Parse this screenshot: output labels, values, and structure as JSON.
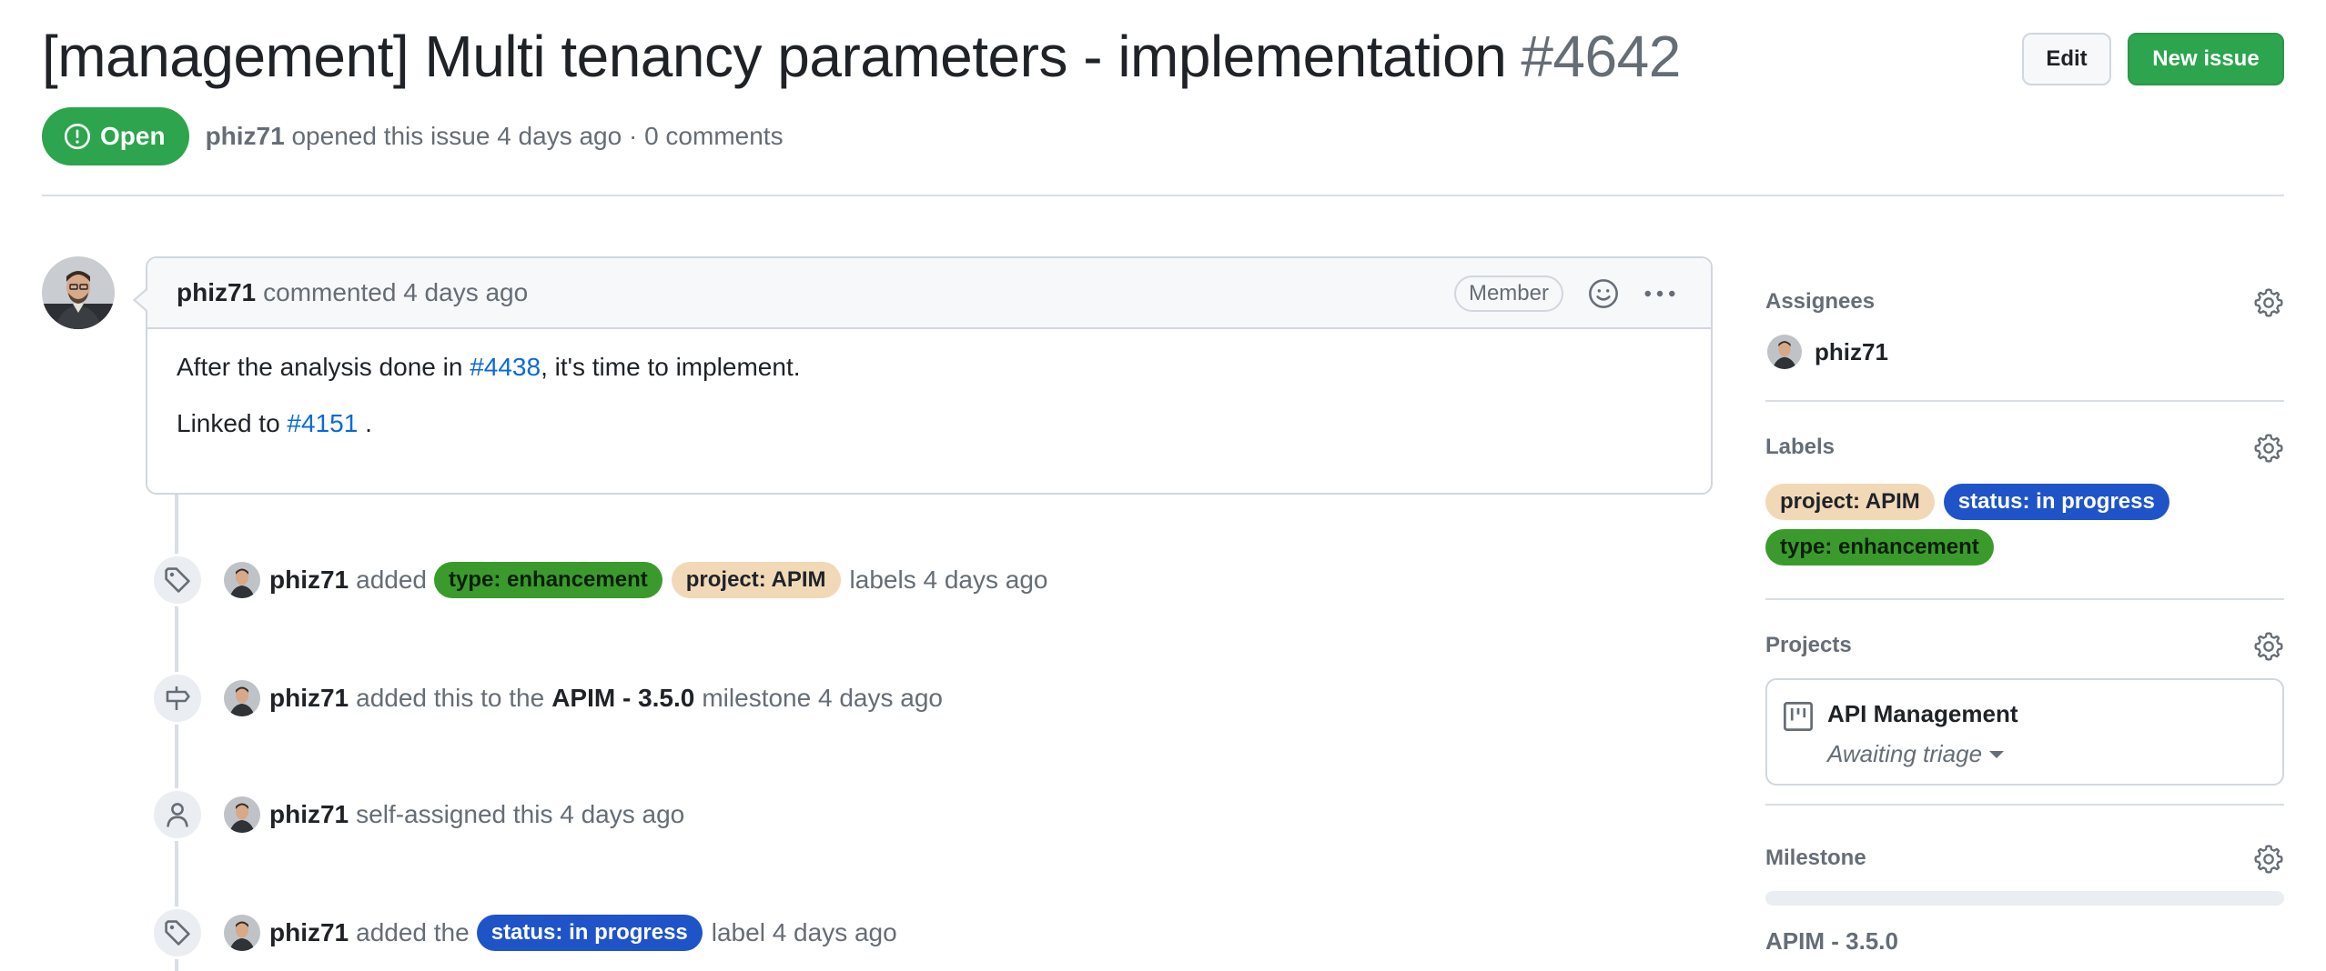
{
  "issue": {
    "title": "[management] Multi tenancy parameters - implementation",
    "number": "#4642",
    "state": "Open",
    "author": "phiz71",
    "opened_text": "opened this issue 4 days ago · 0 comments"
  },
  "actions": {
    "edit_label": "Edit",
    "new_issue_label": "New issue"
  },
  "comment": {
    "author": "phiz71",
    "commented_text": "commented 4 days ago",
    "badge": "Member",
    "body": {
      "line1_before": "After the analysis done in ",
      "line1_link": "#4438",
      "line1_after": ", it's time to implement.",
      "line2_before": "Linked to ",
      "line2_link": "#4151",
      "line2_after": " ."
    }
  },
  "events": [
    {
      "icon": "tag-icon",
      "actor": "phiz71",
      "verb": "added",
      "labels": [
        "type: enhancement",
        "project: APIM"
      ],
      "suffix": "labels 4 days ago"
    },
    {
      "icon": "milestone-icon",
      "actor": "phiz71",
      "verb": "added this to the",
      "milestone": "APIM - 3.5.0",
      "suffix": "milestone 4 days ago"
    },
    {
      "icon": "person-icon",
      "actor": "phiz71",
      "verb": "self-assigned this 4 days ago"
    },
    {
      "icon": "tag-icon",
      "actor": "phiz71",
      "verb": "added the",
      "labels": [
        "status: in progress"
      ],
      "suffix": "label 4 days ago"
    }
  ],
  "sidebar": {
    "assignees": {
      "title": "Assignees",
      "users": [
        "phiz71"
      ]
    },
    "labels": {
      "title": "Labels",
      "items": [
        "project: APIM",
        "status: in progress",
        "type: enhancement"
      ]
    },
    "projects": {
      "title": "Projects",
      "project_name": "API Management",
      "project_status": "Awaiting triage"
    },
    "milestone": {
      "title": "Milestone",
      "name": "APIM - 3.5.0",
      "progress_percent": 0
    }
  },
  "colors": {
    "open_green": "#2da44e",
    "link_blue": "#0969da",
    "label_enhancement": "#3a9b2c",
    "label_apim": "#f1d9b8",
    "label_in_progress": "#1f54c8"
  }
}
